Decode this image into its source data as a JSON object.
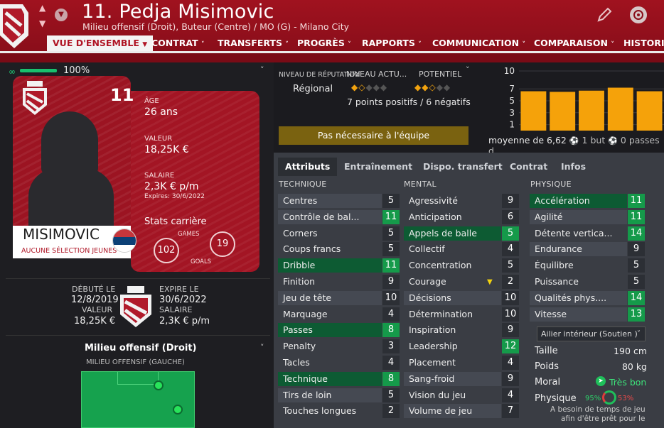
{
  "header": {
    "title": "11. Pedja Misimovic",
    "subtitle": "Milieu offensif (Droit), Buteur (Centre) / MO (G) - Milano City"
  },
  "nav": {
    "items": [
      "VUE D'ENSEMBLE",
      "CONTRAT",
      "TRANSFERTS",
      "PROGRÈS",
      "RAPPORTS",
      "COMMUNICATION",
      "COMPARAISON",
      "HISTORIQ"
    ]
  },
  "condition": {
    "value": "100%",
    "fraction": 1.0
  },
  "card": {
    "number": "11",
    "name": "MISIMOVIC",
    "youth": "AUCUNE SÉLECTION JEUNES",
    "age_label": "ÂGE",
    "age": "26 ans",
    "value_label": "VALEUR",
    "value": "18,25K €",
    "salary_label": "SALAIRE",
    "salary": "2,3K € p/m",
    "expires": "Expires: 30/6/2022",
    "career_label": "Stats carrière",
    "games_label": "GAMES",
    "games": "102",
    "goals_label": "GOALS",
    "goals": "19"
  },
  "debut": {
    "debut_label": "DÉBUTÉ LE",
    "debut_date": "12/8/2019",
    "value_label": "VALEUR",
    "value": "18,25K €",
    "expire_label": "EXPIRE LE",
    "expire_date": "30/6/2022",
    "salary_label": "SALAIRE",
    "salary": "2,3K € p/m"
  },
  "position": {
    "title": "Milieu offensif (Droit)",
    "sub": "MILIEU OFFENSIF (GAUCHE)"
  },
  "reputation": {
    "rep_label": "NIVEAU DE RÉPUTATION",
    "level_label": "NIVEAU ACTU...",
    "potential_label": "POTENTIEL",
    "rep_value": "Régional",
    "current_stars": 1.5,
    "potential_stars": 2.5,
    "points": "7 points positifs / 6 négatifs",
    "status_button": "Pas nécessaire à l'équipe"
  },
  "chart_data": {
    "type": "bar",
    "categories": [
      "1",
      "2",
      "3",
      "4",
      "5"
    ],
    "values": [
      6.6,
      6.5,
      6.7,
      7.2,
      6.6
    ],
    "yticks": [
      "10",
      "7",
      "5",
      "3",
      "1"
    ],
    "ylim": [
      0,
      10
    ],
    "color": "#f5a20a",
    "caption_avg": "moyenne de 6,62",
    "caption_goals": "1 but",
    "caption_passes": "0 passes d"
  },
  "attributes": {
    "tabs": [
      "Attributs",
      "Entraînement",
      "Dispo. transfert",
      "Contrat",
      "Infos"
    ],
    "technique_header": "TECHNIQUE",
    "mental_header": "MENTAL",
    "physique_header": "PHYSIQUE",
    "technique": [
      {
        "name": "Centres",
        "value": "5",
        "style": "n"
      },
      {
        "name": "Contrôle de bal...",
        "value": "11",
        "style": "ng"
      },
      {
        "name": "Corners",
        "value": "5",
        "style": "d"
      },
      {
        "name": "Coups francs",
        "value": "5",
        "style": "d"
      },
      {
        "name": "Dribble",
        "value": "11",
        "style": "g"
      },
      {
        "name": "Finition",
        "value": "9",
        "style": "d"
      },
      {
        "name": "Jeu de tête",
        "value": "10",
        "style": "n"
      },
      {
        "name": "Marquage",
        "value": "4",
        "style": "d"
      },
      {
        "name": "Passes",
        "value": "8",
        "style": "g"
      },
      {
        "name": "Penalty",
        "value": "3",
        "style": "d"
      },
      {
        "name": "Tacles",
        "value": "4",
        "style": "d"
      },
      {
        "name": "Technique",
        "value": "8",
        "style": "g"
      },
      {
        "name": "Tirs de loin",
        "value": "5",
        "style": "n"
      },
      {
        "name": "Touches longues",
        "value": "2",
        "style": "d"
      }
    ],
    "mental": [
      {
        "name": "Agressivité",
        "value": "9",
        "style": "d"
      },
      {
        "name": "Anticipation",
        "value": "6",
        "style": "d"
      },
      {
        "name": "Appels de balle",
        "value": "5",
        "style": "g"
      },
      {
        "name": "Collectif",
        "value": "4",
        "style": "d"
      },
      {
        "name": "Concentration",
        "value": "5",
        "style": "d"
      },
      {
        "name": "Courage",
        "value": "2",
        "style": "d"
      },
      {
        "name": "Décisions",
        "value": "10",
        "style": "n"
      },
      {
        "name": "Détermination",
        "value": "10",
        "style": "d"
      },
      {
        "name": "Inspiration",
        "value": "9",
        "style": "d"
      },
      {
        "name": "Leadership",
        "value": "12",
        "style": "dg"
      },
      {
        "name": "Placement",
        "value": "4",
        "style": "d"
      },
      {
        "name": "Sang-froid",
        "value": "9",
        "style": "n"
      },
      {
        "name": "Vision du jeu",
        "value": "4",
        "style": "d"
      },
      {
        "name": "Volume de jeu",
        "value": "7",
        "style": "n"
      }
    ],
    "physique": [
      {
        "name": "Accélération",
        "value": "11",
        "style": "g"
      },
      {
        "name": "Agilité",
        "value": "11",
        "style": "ng"
      },
      {
        "name": "Détente vertica...",
        "value": "14",
        "style": "dg"
      },
      {
        "name": "Endurance",
        "value": "9",
        "style": "n"
      },
      {
        "name": "Équilibre",
        "value": "5",
        "style": "d"
      },
      {
        "name": "Puissance",
        "value": "5",
        "style": "d"
      },
      {
        "name": "Qualités phys....",
        "value": "14",
        "style": "ng"
      },
      {
        "name": "Vitesse",
        "value": "13",
        "style": "ng"
      }
    ]
  },
  "bio": {
    "role": "Ailier intérieur (Soutien )",
    "height_label": "Taille",
    "height": "190 cm",
    "weight_label": "Poids",
    "weight": "80 kg",
    "morale_label": "Moral",
    "morale": "Très bon",
    "physique_label": "Physique",
    "physique_pct1": "95%",
    "physique_pct2": "53%",
    "note1": "A besoin de temps de jeu",
    "note2": "afin d'être prêt pour le"
  }
}
